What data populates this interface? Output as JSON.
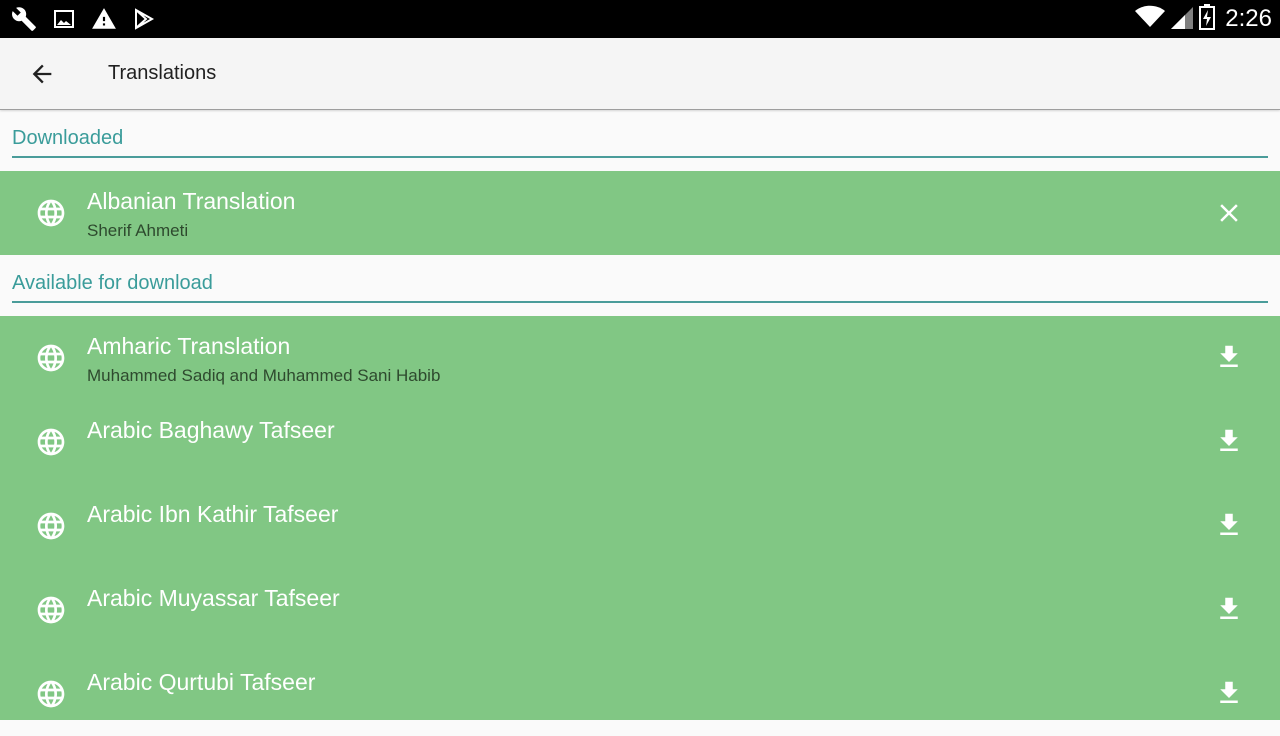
{
  "status_bar": {
    "time": "2:26",
    "left_icons": [
      "wrench-icon",
      "image-icon",
      "warning-icon",
      "play-store-icon"
    ],
    "right_icons": [
      "wifi-icon",
      "cell-signal-icon",
      "battery-charging-icon"
    ]
  },
  "app_bar": {
    "title": "Translations",
    "back_icon": "arrow-back-icon"
  },
  "sections": {
    "downloaded": {
      "label": "Downloaded",
      "items": [
        {
          "title": "Albanian Translation",
          "subtitle": "Sherif Ahmeti",
          "action_icon": "close-icon"
        }
      ]
    },
    "available": {
      "label": "Available for download",
      "items": [
        {
          "title": "Amharic Translation",
          "subtitle": "Muhammed Sadiq and Muhammed Sani Habib",
          "action_icon": "download-icon"
        },
        {
          "title": "Arabic Baghawy Tafseer",
          "subtitle": "",
          "action_icon": "download-icon"
        },
        {
          "title": "Arabic Ibn Kathir Tafseer",
          "subtitle": "",
          "action_icon": "download-icon"
        },
        {
          "title": "Arabic Muyassar Tafseer",
          "subtitle": "",
          "action_icon": "download-icon"
        },
        {
          "title": "Arabic Qurtubi Tafseer",
          "subtitle": "",
          "action_icon": "download-icon"
        }
      ]
    }
  },
  "colors": {
    "status_bar": "#000000",
    "app_bar": "#f5f5f5",
    "section_accent": "#3a9c9a",
    "row_background": "#81c784",
    "row_title": "#ffffff",
    "row_subtitle": "#2e4a2e"
  }
}
